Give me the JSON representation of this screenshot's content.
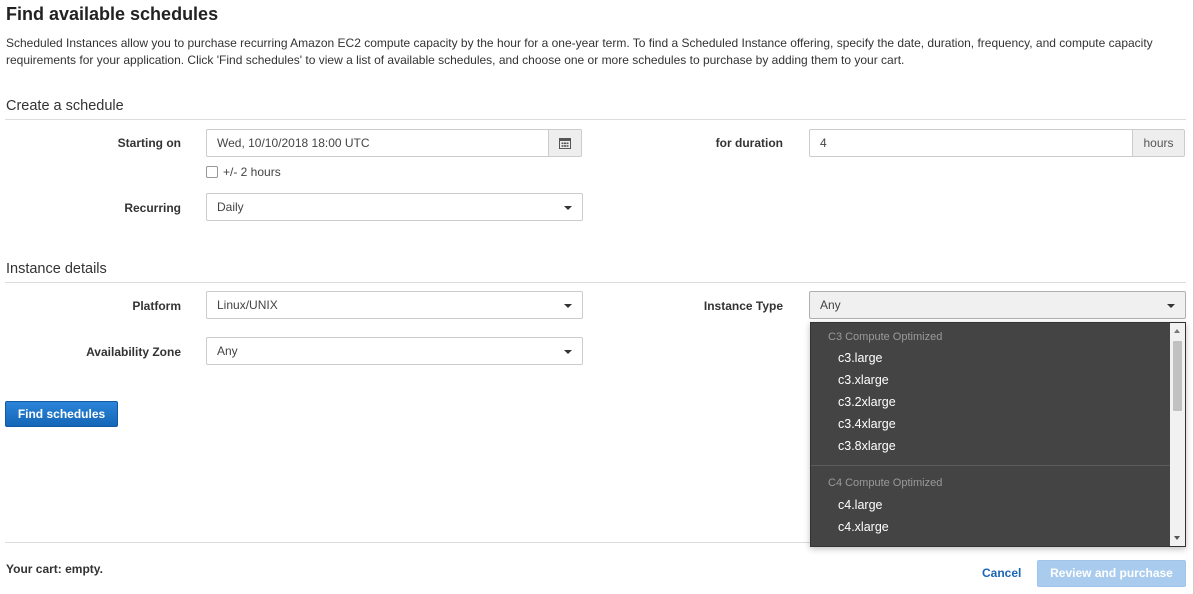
{
  "page": {
    "title": "Find available schedules",
    "intro": "Scheduled Instances allow you to purchase recurring Amazon EC2 compute capacity by the hour for a one-year term. To find a Scheduled Instance offering, specify the date, duration, frequency, and compute capacity requirements for your application. Click 'Find schedules' to view a list of available schedules, and choose one or more schedules to purchase by adding them to your cart."
  },
  "schedule": {
    "section_title": "Create a schedule",
    "starting_on_label": "Starting on",
    "starting_on_value": "Wed, 10/10/2018 18:00 UTC",
    "calendar_icon": "calendar-icon",
    "flex_label": "+/- 2 hours",
    "duration_label": "for duration",
    "duration_value": "4",
    "duration_unit": "hours",
    "recurring_label": "Recurring",
    "recurring_value": "Daily"
  },
  "instance": {
    "section_title": "Instance details",
    "platform_label": "Platform",
    "platform_value": "Linux/UNIX",
    "az_label": "Availability Zone",
    "az_value": "Any",
    "type_label": "Instance Type",
    "type_value": "Any",
    "dropdown": {
      "groups": [
        {
          "label": "C3 Compute Optimized",
          "items": [
            "c3.large",
            "c3.xlarge",
            "c3.2xlarge",
            "c3.4xlarge",
            "c3.8xlarge"
          ]
        },
        {
          "label": "C4 Compute Optimized",
          "items": [
            "c4.large",
            "c4.xlarge"
          ]
        }
      ]
    }
  },
  "actions": {
    "find_label": "Find schedules",
    "cart_label": "Your cart: empty.",
    "cancel_label": "Cancel",
    "review_label": "Review and purchase"
  },
  "colors": {
    "primary": "#1a6fc4",
    "link": "#1b66b6",
    "disabled": "#a9cbee",
    "dropdown_bg": "#444444"
  }
}
